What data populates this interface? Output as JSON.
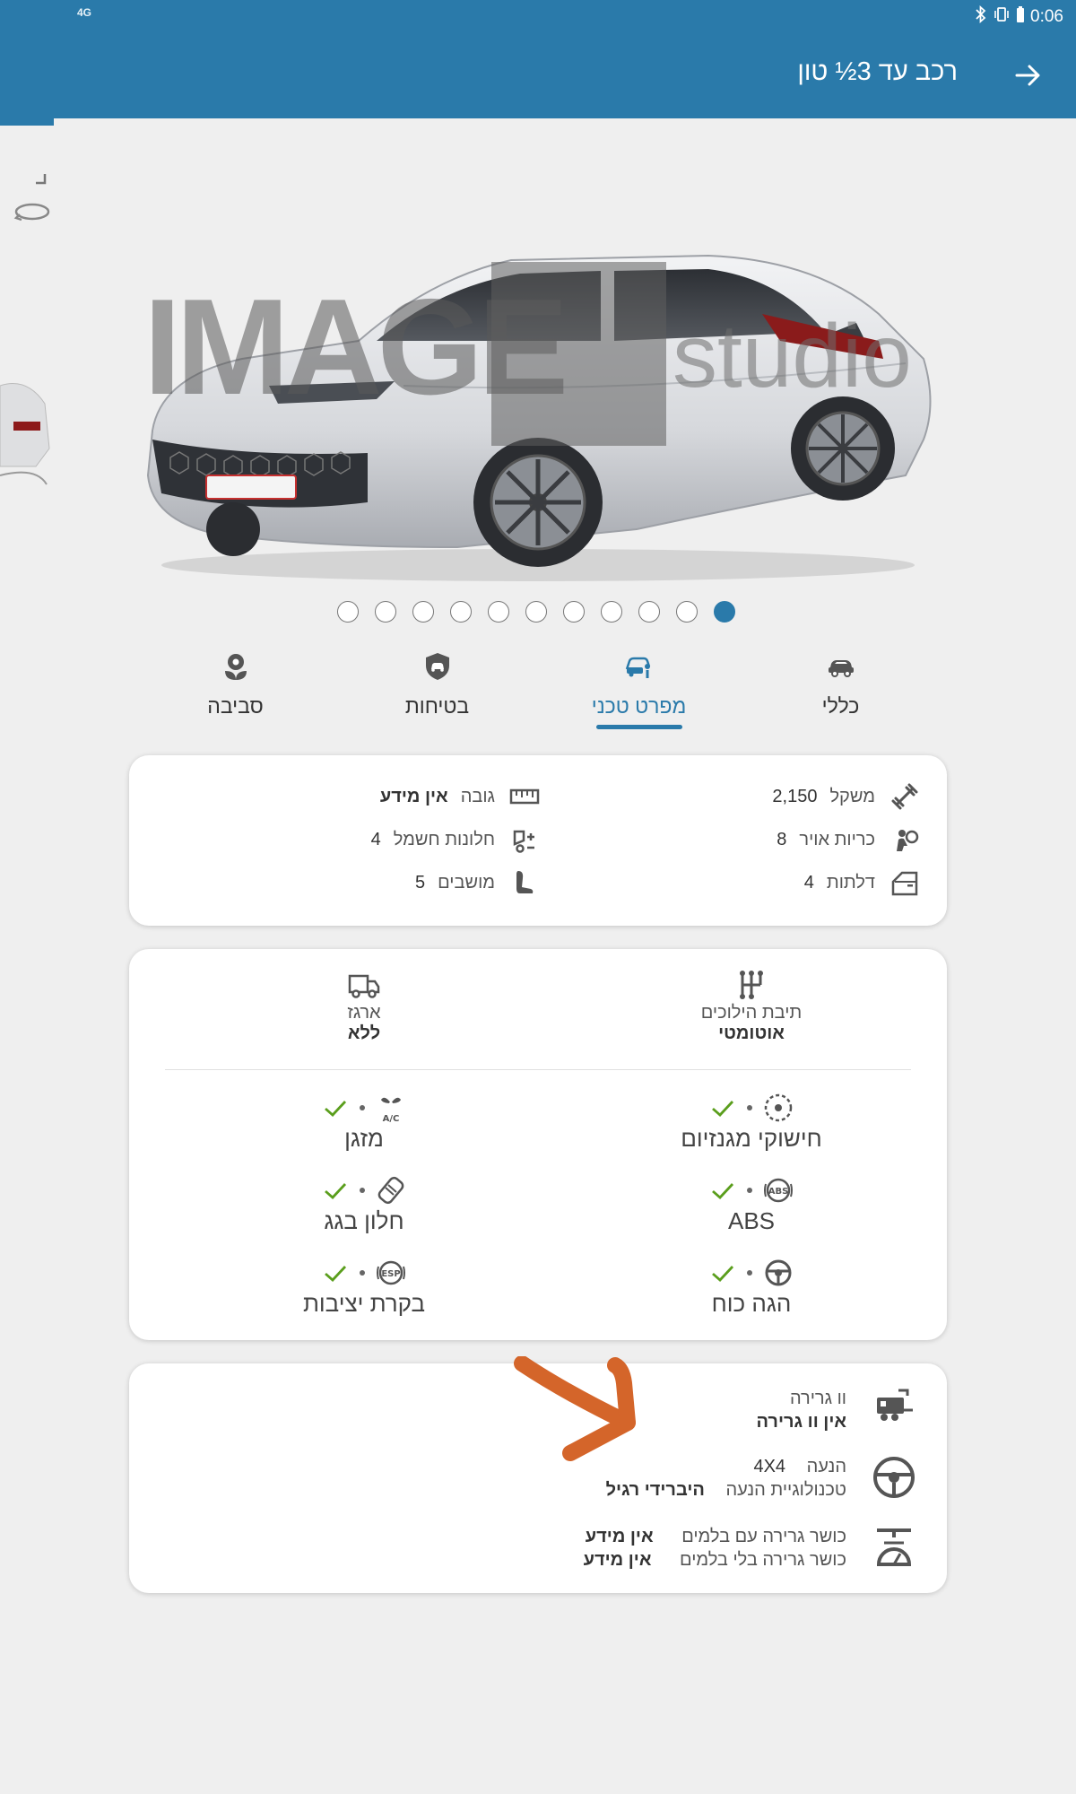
{
  "status_bar": {
    "left_text": "4G",
    "time": "0:06"
  },
  "header": {
    "title": "רכב עד 3½ טון"
  },
  "carousel": {
    "dots_count": 11,
    "active_index": 10
  },
  "tabs": [
    {
      "label": "כללי",
      "icon": "car-icon"
    },
    {
      "label": "מפרט טכני",
      "icon": "car-spec-icon",
      "active": true
    },
    {
      "label": "בטיחות",
      "icon": "shield-car-icon"
    },
    {
      "label": "סביבה",
      "icon": "eco-flower-icon"
    }
  ],
  "specs": {
    "weight_label": "משקל",
    "weight_value": "2,150",
    "height_label": "גובה",
    "height_value": "אין מידע",
    "airbags_label": "כריות אויר",
    "airbags_value": "8",
    "power_windows_label": "חלונות חשמל",
    "power_windows_value": "4",
    "doors_label": "דלתות",
    "doors_value": "4",
    "seats_label": "מושבים",
    "seats_value": "5"
  },
  "transmission": {
    "gearbox_label": "תיבת הילוכים",
    "gearbox_value": "אוטומטי",
    "trunk_label": "ארגז",
    "trunk_value": "ללא"
  },
  "features": [
    {
      "label": "חישוקי מגנזיום",
      "icon": "magnesium-rim-icon"
    },
    {
      "label": "מזגן",
      "icon": "ac-icon"
    },
    {
      "label": "ABS",
      "icon": "abs-icon"
    },
    {
      "label": "חלון בגג",
      "icon": "sunroof-icon"
    },
    {
      "label": "הגה כוח",
      "icon": "power-steering-icon"
    },
    {
      "label": "בקרת יציבות",
      "icon": "esp-icon"
    }
  ],
  "towing": {
    "hook_label": "וו גרירה",
    "hook_value": "אין וו גרירה",
    "drive_label": "הנעה",
    "drive_value": "4X4",
    "drive_tech_label": "טכנולוגיית הנעה",
    "drive_tech_value": "היברידי רגיל",
    "tow_braked_label": "כושר גרירה עם בלמים",
    "tow_braked_value": "אין מידע",
    "tow_unbraked_label": "כושר גרירה בלי בלמים",
    "tow_unbraked_value": "אין מידע"
  },
  "watermark": {
    "text": "IMAGE",
    "suffix": "studio"
  },
  "colors": {
    "primary": "#2a7aaa",
    "check_green": "#5a9e1c",
    "annotation_orange": "#d4652a"
  }
}
